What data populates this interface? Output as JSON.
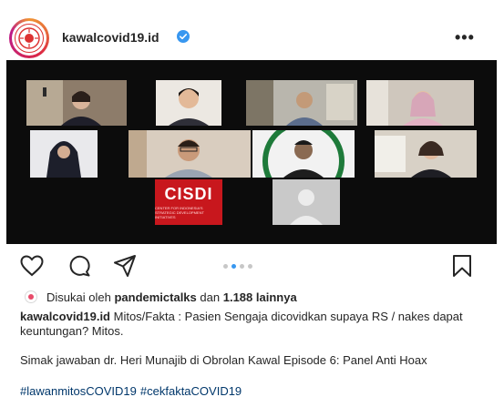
{
  "post": {
    "username": "kawalcovid19.id",
    "more_label": "•••"
  },
  "video_call": {
    "cisdi_label": "CISDI",
    "cisdi_sub": "CENTER FOR INDONESIA'S STRATEGIC DEVELOPMENT INITIATIVES"
  },
  "carousel": {
    "count": 4,
    "active_index": 1
  },
  "likes": {
    "prefix": "Disukai oleh",
    "user": "pandemictalks",
    "connector": "dan",
    "count": "1.188 lainnya"
  },
  "caption": {
    "username": "kawalcovid19.id",
    "text1": "Mitos/Fakta : Pasien Sengaja dicovidkan supaya RS / nakes dapat keuntungan? Mitos.",
    "text2": "Simak jawaban dr. Heri Munajib di Obrolan Kawal Episode 6: Panel Anti Hoax"
  },
  "hashtags": [
    "#lawanmitosCOVID19",
    "#cekfaktaCOVID19"
  ],
  "colors": {
    "verified": "#3897f0",
    "hashtag": "#00376b",
    "cisdi": "#c8171d"
  }
}
